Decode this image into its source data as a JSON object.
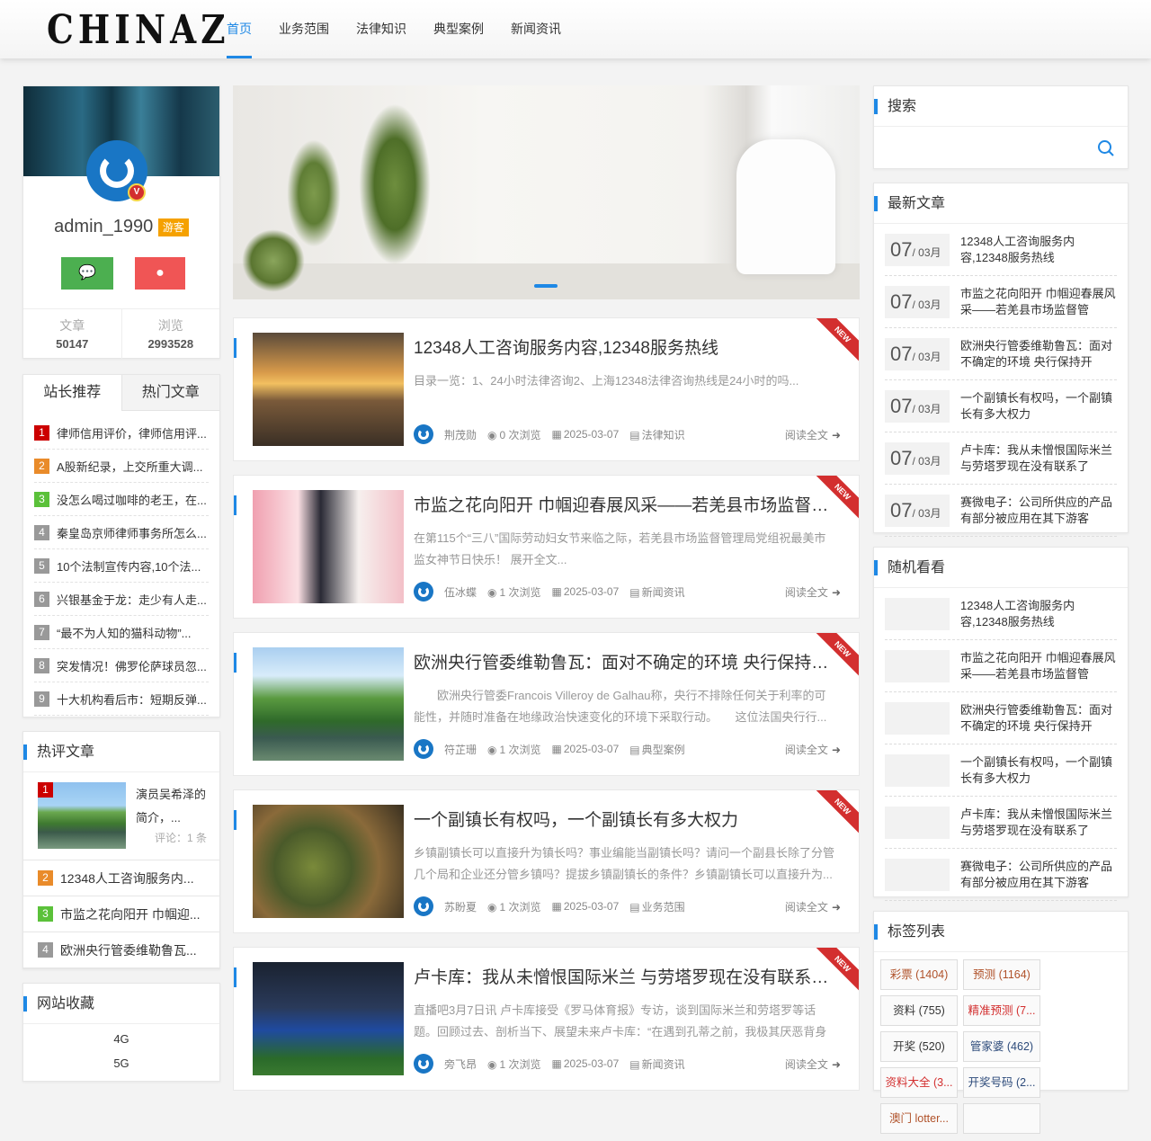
{
  "header": {
    "logo": "CHINAZ",
    "nav": [
      "首页",
      "业务范围",
      "法律知识",
      "典型案例",
      "新闻资讯"
    ]
  },
  "user": {
    "name": "admin_1990",
    "role": "游客",
    "stats": [
      {
        "label": "文章",
        "value": "50147"
      },
      {
        "label": "浏览",
        "value": "2993528"
      }
    ]
  },
  "tabs": [
    "站长推荐",
    "热门文章"
  ],
  "recommend": [
    "律师信用评价，律师信用评...",
    "A股新纪录，上交所重大调...",
    "没怎么喝过咖啡的老王，在...",
    "秦皇岛京师律师事务所怎么...",
    "10个法制宣传内容,10个法...",
    "兴银基金于龙：走少有人走...",
    "“最不为人知的猫科动物”...",
    "突发情况！佛罗伦萨球员忽...",
    "十大机构看后市：短期反弹..."
  ],
  "hot_comments": {
    "title": "热评文章",
    "first": {
      "title": "演员吴希泽的简介，...",
      "comments": "评论：1 条"
    },
    "items": [
      "12348人工咨询服务内...",
      "市监之花向阳开 巾帼迎...",
      "欧洲央行管委维勒鲁瓦..."
    ]
  },
  "favorites": {
    "title": "网站收藏",
    "items": [
      "4G",
      "5G"
    ]
  },
  "posts": [
    {
      "title": "12348人工咨询服务内容,12348服务热线",
      "excerpt": "目录一览：1、24小时法律咨询2、上海12348法律咨询热线是24小时的吗...",
      "author": "荆茂勋",
      "views": "0 次浏览",
      "date": "2025-03-07",
      "category": "法律知识"
    },
    {
      "title": "市监之花向阳开 巾帼迎春展风采——若羌县市场监督管理...",
      "excerpt": "在第115个“三八”国际劳动妇女节来临之际，若羌县市场监督管理局党组祝最美市监女神节日快乐！ 展开全文...",
      "author": "伍冰蝶",
      "views": "1 次浏览",
      "date": "2025-03-07",
      "category": "新闻资讯"
    },
    {
      "title": "欧洲央行管委维勒鲁瓦：面对不确定的环境 央行保持开放...",
      "excerpt": "　　欧洲央行管委Francois Villeroy de Galhau称，央行不排除任何关于利率的可能性，并随时准备在地缘政治快速变化的环境下采取行动。　　这位法国央行行...",
      "author": "符芷珊",
      "views": "1 次浏览",
      "date": "2025-03-07",
      "category": "典型案例"
    },
    {
      "title": "一个副镇长有权吗，一个副镇长有多大权力",
      "excerpt": "乡镇副镇长可以直接升为镇长吗？事业编能当副镇长吗？请问一个副县长除了分管几个局和企业还分管乡镇吗？提拔乡镇副镇长的条件？乡镇副镇长可以直接升为...",
      "author": "苏盼夏",
      "views": "1 次浏览",
      "date": "2025-03-07",
      "category": "业务范围"
    },
    {
      "title": "卢卡库：我从未憎恨国际米兰 与劳塔罗现在没有联系了 他...",
      "excerpt": "直播吧3月7日讯 卢卡库接受《罗马体育报》专访，谈到国际米兰和劳塔罗等话题。回顾过去、剖析当下、展望未来卢卡库：“在遇到孔蒂之前，我极其厌恶背身接...",
      "author": "旁飞昂",
      "views": "1 次浏览",
      "date": "2025-03-07",
      "category": "新闻资讯"
    }
  ],
  "post_ui": {
    "read_more": "阅读全文",
    "new_badge": "NEW"
  },
  "search": {
    "title": "搜索",
    "placeholder": ""
  },
  "latest": {
    "title": "最新文章",
    "day": "07",
    "month": "/ 03月",
    "items": [
      "12348人工咨询服务内容,12348服务热线",
      "市监之花向阳开 巾帼迎春展风采——若羌县市场监督管",
      "欧洲央行管委维勒鲁瓦：面对不确定的环境 央行保持开",
      "一个副镇长有权吗，一个副镇长有多大权力",
      "卢卡库：我从未憎恨国际米兰 与劳塔罗现在没有联系了",
      "赛微电子：公司所供应的产品有部分被应用在其下游客"
    ]
  },
  "random": {
    "title": "随机看看",
    "items": [
      "12348人工咨询服务内容,12348服务热线",
      "市监之花向阳开 巾帼迎春展风采——若羌县市场监督管",
      "欧洲央行管委维勒鲁瓦：面对不确定的环境 央行保持开",
      "一个副镇长有权吗，一个副镇长有多大权力",
      "卢卡库：我从未憎恨国际米兰 与劳塔罗现在没有联系了",
      "赛微电子：公司所供应的产品有部分被应用在其下游客"
    ]
  },
  "tagbox": {
    "title": "标签列表",
    "tags": [
      {
        "label": "彩票 (1404)",
        "color": "#b0522a"
      },
      {
        "label": "预测 (1164)",
        "color": "#b0522a"
      },
      {
        "label": "资料 (755)",
        "color": "#333333"
      },
      {
        "label": "精准预测 (7...",
        "color": "#d32f2f"
      },
      {
        "label": "开奖 (520)",
        "color": "#333333"
      },
      {
        "label": "管家婆 (462)",
        "color": "#2c4a7a"
      },
      {
        "label": "资料大全 (3...",
        "color": "#d32f2f"
      },
      {
        "label": "开奖号码 (2...",
        "color": "#2c4a7a"
      },
      {
        "label": "澳门 lotter...",
        "color": "#b0522a"
      }
    ]
  }
}
